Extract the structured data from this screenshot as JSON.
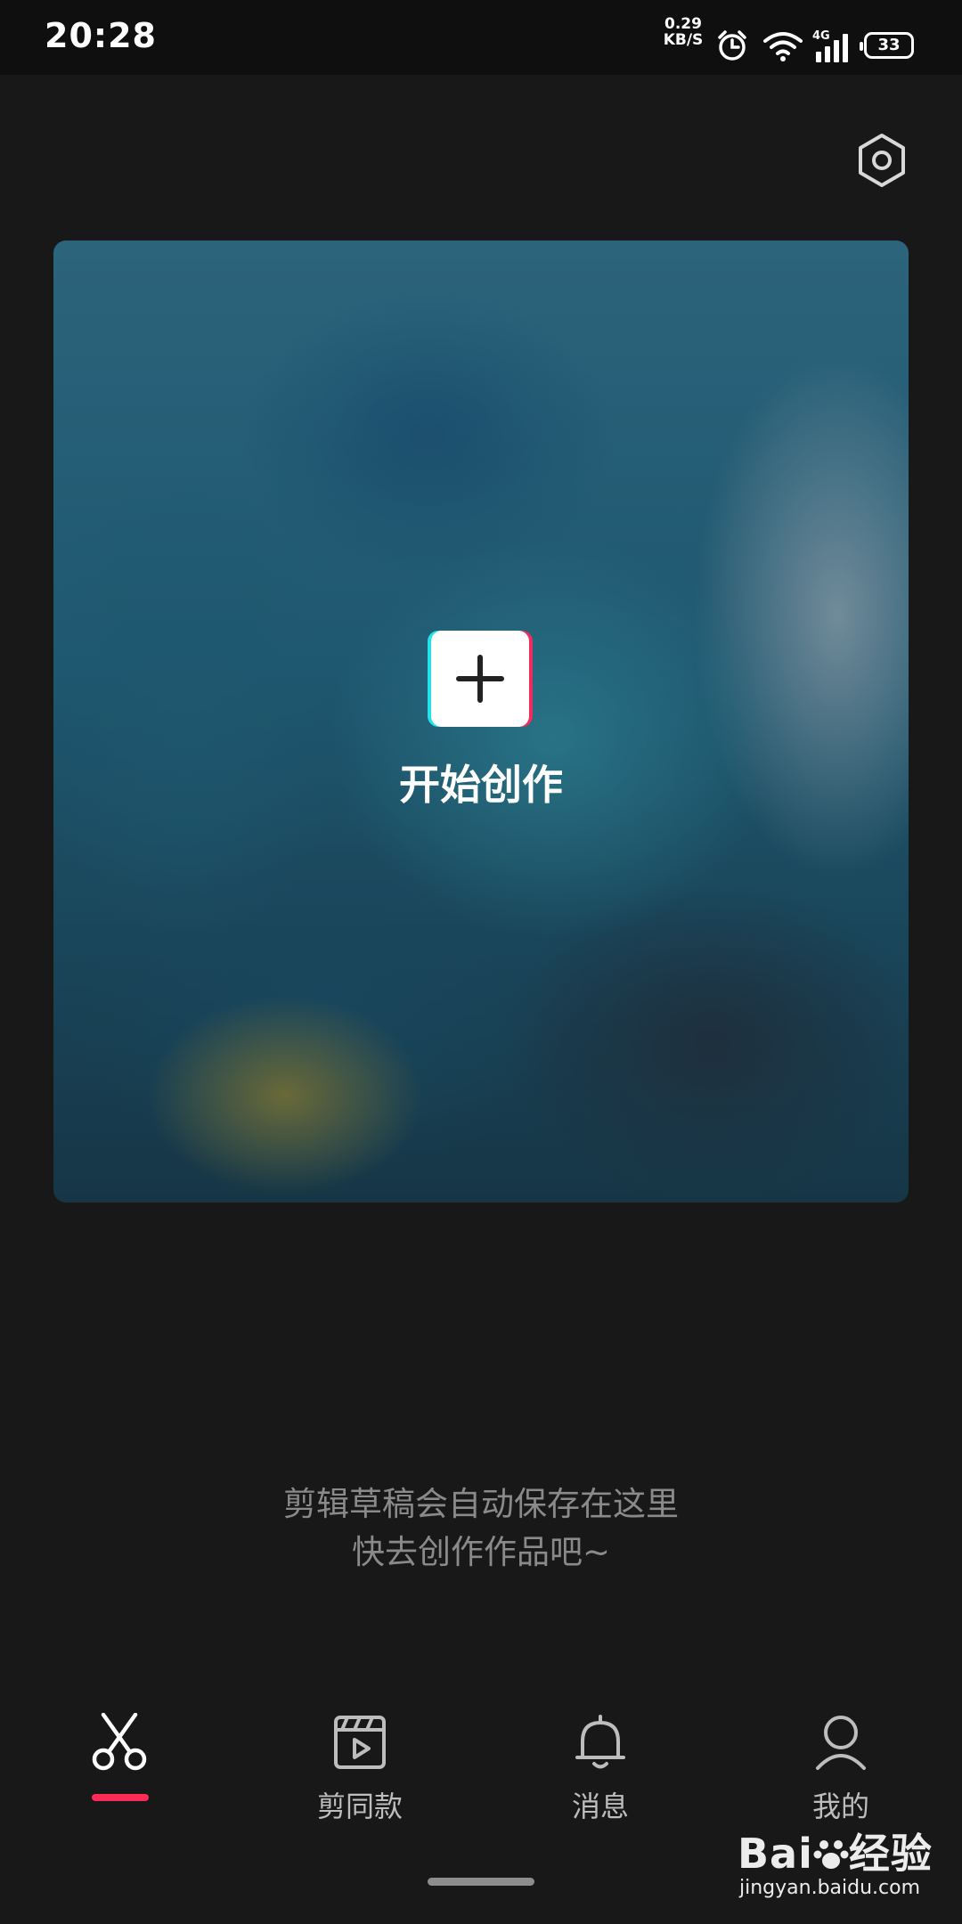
{
  "status_bar": {
    "time": "20:28",
    "net_speed_value": "0.29",
    "net_speed_unit": "KB/S",
    "network_type": "4G",
    "battery_level": "33",
    "icons": [
      "alarm-icon",
      "wifi-icon",
      "cellular-signal-icon",
      "battery-icon"
    ]
  },
  "header": {
    "settings_icon": "hexagon-settings-icon"
  },
  "hero": {
    "start_label": "开始创作",
    "plus_icon": "plus-icon",
    "colors": {
      "cyan": "#23e3e6",
      "red": "#f12b5b"
    }
  },
  "empty_state": {
    "line1": "剪辑草稿会自动保存在这里",
    "line2": "快去创作作品吧~"
  },
  "tab_bar": {
    "active_index": 0,
    "accent_color": "#fe2c55",
    "tabs": [
      {
        "icon": "scissors-icon",
        "label": ""
      },
      {
        "icon": "video-template-icon",
        "label": "剪同款"
      },
      {
        "icon": "bell-icon",
        "label": "消息"
      },
      {
        "icon": "person-icon",
        "label": "我的"
      }
    ]
  },
  "watermark": {
    "brand": "Bai",
    "brand_suffix": "经验",
    "url": "jingyan.baidu.com"
  }
}
